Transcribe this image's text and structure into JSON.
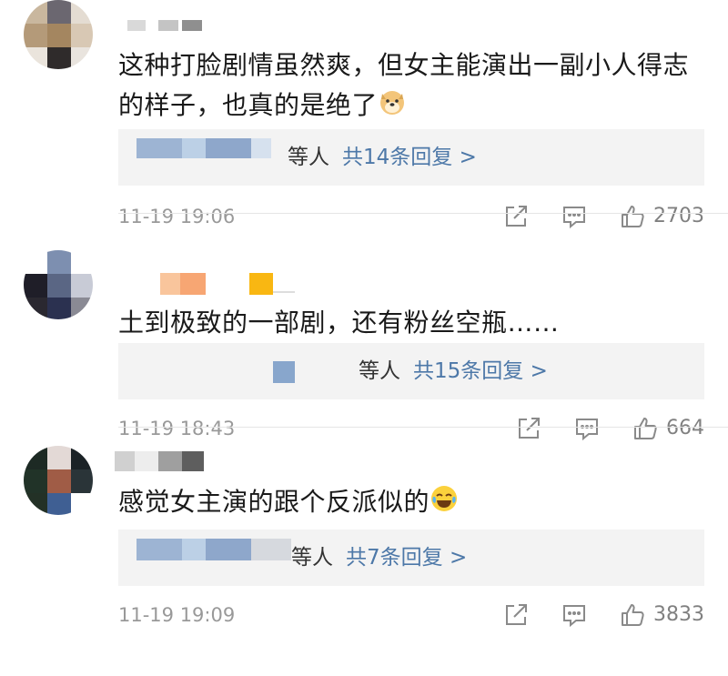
{
  "comments": [
    {
      "text": "这种打脸剧情虽然爽，但女主能演出一副小人得志的样子，也真的是绝了",
      "emoji_icon": "doge-emoji-icon",
      "reply_etc": "等人",
      "reply_link": "共14条回复 >",
      "time": "11-19 19:06",
      "likes": "2703"
    },
    {
      "text": "土到极致的一部剧，还有粉丝空瓶……",
      "emoji_icon": "",
      "reply_etc": "等人",
      "reply_link": "共15条回复 >",
      "time": "11-19 18:43",
      "likes": "664"
    },
    {
      "text": "感觉女主演的跟个反派似的",
      "emoji_icon": "laugh-cry-emoji-icon",
      "reply_etc": "等人",
      "reply_link": "共7条回复 >",
      "time": "11-19 19:09",
      "likes": "3833"
    }
  ],
  "icons": {
    "share": "share-icon",
    "reply": "comment-icon",
    "like": "thumbs-up-icon"
  },
  "colors": {
    "link": "#4d78a8",
    "muted": "#999999",
    "reply_bg": "#f3f3f3"
  }
}
